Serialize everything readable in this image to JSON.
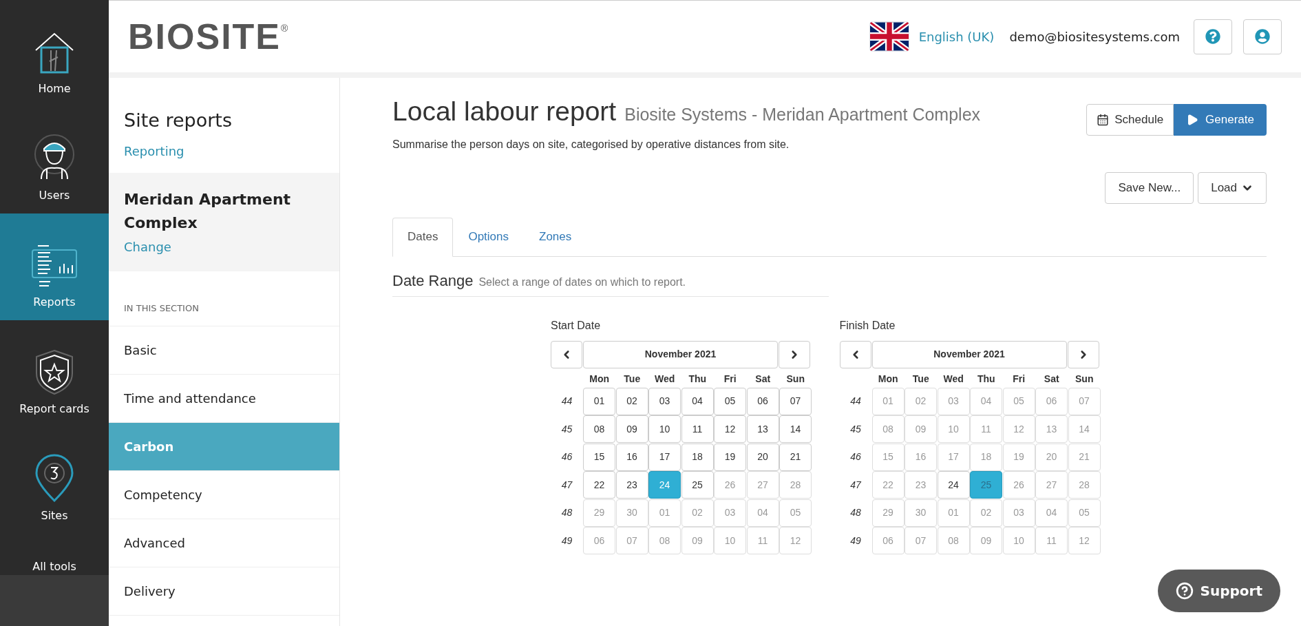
{
  "nav": [
    {
      "label": "Home",
      "kind": "house",
      "selected": false
    },
    {
      "label": "Users",
      "kind": "worker",
      "selected": false
    },
    {
      "label": "Reports",
      "kind": "report",
      "selected": true
    },
    {
      "label": "Report cards",
      "kind": "shield",
      "selected": false
    },
    {
      "label": "Sites",
      "kind": "pin",
      "selected": false
    },
    {
      "label": "All tools",
      "kind": "text",
      "selected": false
    }
  ],
  "header": {
    "logo": "BIOSITE",
    "logo_mark": "®",
    "language": "English (UK)",
    "email": "demo@biositesystems.com"
  },
  "sidebar": {
    "title": "Site reports",
    "link": "Reporting",
    "site": "Meridan Apartment Complex",
    "site_link": "Change",
    "section": "IN THIS SECTION",
    "items": [
      {
        "label": "Basic",
        "selected": false
      },
      {
        "label": "Time and attendance",
        "selected": false
      },
      {
        "label": "Carbon",
        "selected": true
      },
      {
        "label": "Competency",
        "selected": false
      },
      {
        "label": "Advanced",
        "selected": false
      },
      {
        "label": "Delivery",
        "selected": false
      }
    ]
  },
  "report": {
    "title": "Local labour report",
    "subtitle": "Biosite Systems - Meridan Apartment Complex",
    "description": "Summarise the person days on site, categorised by operative distances from site.",
    "buttons": [
      {
        "label": "Schedule",
        "kind": "schedule"
      },
      {
        "label": "Generate",
        "kind": "generate"
      }
    ],
    "save_buttons": [
      {
        "label": "Save New...",
        "kind": "plain"
      },
      {
        "label": "Load",
        "kind": "dropdown"
      }
    ]
  },
  "tabs": [
    {
      "label": "Dates",
      "selected": true
    },
    {
      "label": "Options",
      "selected": false
    },
    {
      "label": "Zones",
      "selected": false
    }
  ],
  "date_range": {
    "title": "Date Range",
    "hint": "Select a range of dates on which to report."
  },
  "calendars": [
    {
      "label": "Start Date",
      "month": "November 2021",
      "weekdays": [
        "Mon",
        "Tue",
        "Wed",
        "Thu",
        "Fri",
        "Sat",
        "Sun"
      ],
      "weeks": [
        {
          "week": "44",
          "days": [
            {
              "label": "01",
              "disabled": false,
              "selected": false
            },
            {
              "label": "02",
              "disabled": false,
              "selected": false
            },
            {
              "label": "03",
              "disabled": false,
              "selected": false
            },
            {
              "label": "04",
              "disabled": false,
              "selected": false
            },
            {
              "label": "05",
              "disabled": false,
              "selected": false
            },
            {
              "label": "06",
              "disabled": false,
              "selected": false
            },
            {
              "label": "07",
              "disabled": false,
              "selected": false
            }
          ]
        },
        {
          "week": "45",
          "days": [
            {
              "label": "08",
              "disabled": false,
              "selected": false
            },
            {
              "label": "09",
              "disabled": false,
              "selected": false
            },
            {
              "label": "10",
              "disabled": false,
              "selected": false
            },
            {
              "label": "11",
              "disabled": false,
              "selected": false
            },
            {
              "label": "12",
              "disabled": false,
              "selected": false
            },
            {
              "label": "13",
              "disabled": false,
              "selected": false
            },
            {
              "label": "14",
              "disabled": false,
              "selected": false
            }
          ]
        },
        {
          "week": "46",
          "days": [
            {
              "label": "15",
              "disabled": false,
              "selected": false
            },
            {
              "label": "16",
              "disabled": false,
              "selected": false
            },
            {
              "label": "17",
              "disabled": false,
              "selected": false
            },
            {
              "label": "18",
              "disabled": false,
              "selected": false
            },
            {
              "label": "19",
              "disabled": false,
              "selected": false
            },
            {
              "label": "20",
              "disabled": false,
              "selected": false
            },
            {
              "label": "21",
              "disabled": false,
              "selected": false
            }
          ]
        },
        {
          "week": "47",
          "days": [
            {
              "label": "22",
              "disabled": false,
              "selected": false
            },
            {
              "label": "23",
              "disabled": false,
              "selected": false
            },
            {
              "label": "24",
              "disabled": false,
              "selected": true
            },
            {
              "label": "25",
              "disabled": false,
              "selected": false
            },
            {
              "label": "26",
              "disabled": true,
              "selected": false
            },
            {
              "label": "27",
              "disabled": true,
              "selected": false
            },
            {
              "label": "28",
              "disabled": true,
              "selected": false
            }
          ]
        },
        {
          "week": "48",
          "days": [
            {
              "label": "29",
              "disabled": true,
              "selected": false
            },
            {
              "label": "30",
              "disabled": true,
              "selected": false
            },
            {
              "label": "01",
              "disabled": true,
              "selected": false
            },
            {
              "label": "02",
              "disabled": true,
              "selected": false
            },
            {
              "label": "03",
              "disabled": true,
              "selected": false
            },
            {
              "label": "04",
              "disabled": true,
              "selected": false
            },
            {
              "label": "05",
              "disabled": true,
              "selected": false
            }
          ]
        },
        {
          "week": "49",
          "days": [
            {
              "label": "06",
              "disabled": true,
              "selected": false
            },
            {
              "label": "07",
              "disabled": true,
              "selected": false
            },
            {
              "label": "08",
              "disabled": true,
              "selected": false
            },
            {
              "label": "09",
              "disabled": true,
              "selected": false
            },
            {
              "label": "10",
              "disabled": true,
              "selected": false
            },
            {
              "label": "11",
              "disabled": true,
              "selected": false
            },
            {
              "label": "12",
              "disabled": true,
              "selected": false
            }
          ]
        }
      ]
    },
    {
      "label": "Finish Date",
      "month": "November 2021",
      "weekdays": [
        "Mon",
        "Tue",
        "Wed",
        "Thu",
        "Fri",
        "Sat",
        "Sun"
      ],
      "weeks": [
        {
          "week": "44",
          "days": [
            {
              "label": "01",
              "disabled": true,
              "selected": false
            },
            {
              "label": "02",
              "disabled": true,
              "selected": false
            },
            {
              "label": "03",
              "disabled": true,
              "selected": false
            },
            {
              "label": "04",
              "disabled": true,
              "selected": false
            },
            {
              "label": "05",
              "disabled": true,
              "selected": false
            },
            {
              "label": "06",
              "disabled": true,
              "selected": false
            },
            {
              "label": "07",
              "disabled": true,
              "selected": false
            }
          ]
        },
        {
          "week": "45",
          "days": [
            {
              "label": "08",
              "disabled": true,
              "selected": false
            },
            {
              "label": "09",
              "disabled": true,
              "selected": false
            },
            {
              "label": "10",
              "disabled": true,
              "selected": false
            },
            {
              "label": "11",
              "disabled": true,
              "selected": false
            },
            {
              "label": "12",
              "disabled": true,
              "selected": false
            },
            {
              "label": "13",
              "disabled": true,
              "selected": false
            },
            {
              "label": "14",
              "disabled": true,
              "selected": false
            }
          ]
        },
        {
          "week": "46",
          "days": [
            {
              "label": "15",
              "disabled": true,
              "selected": false
            },
            {
              "label": "16",
              "disabled": true,
              "selected": false
            },
            {
              "label": "17",
              "disabled": true,
              "selected": false
            },
            {
              "label": "18",
              "disabled": true,
              "selected": false
            },
            {
              "label": "19",
              "disabled": true,
              "selected": false
            },
            {
              "label": "20",
              "disabled": true,
              "selected": false
            },
            {
              "label": "21",
              "disabled": true,
              "selected": false
            }
          ]
        },
        {
          "week": "47",
          "days": [
            {
              "label": "22",
              "disabled": true,
              "selected": false
            },
            {
              "label": "23",
              "disabled": true,
              "selected": false
            },
            {
              "label": "24",
              "disabled": false,
              "selected": false
            },
            {
              "label": "25",
              "disabled": true,
              "selected": true
            },
            {
              "label": "26",
              "disabled": true,
              "selected": false
            },
            {
              "label": "27",
              "disabled": true,
              "selected": false
            },
            {
              "label": "28",
              "disabled": true,
              "selected": false
            }
          ]
        },
        {
          "week": "48",
          "days": [
            {
              "label": "29",
              "disabled": true,
              "selected": false
            },
            {
              "label": "30",
              "disabled": true,
              "selected": false
            },
            {
              "label": "01",
              "disabled": true,
              "selected": false
            },
            {
              "label": "02",
              "disabled": true,
              "selected": false
            },
            {
              "label": "03",
              "disabled": true,
              "selected": false
            },
            {
              "label": "04",
              "disabled": true,
              "selected": false
            },
            {
              "label": "05",
              "disabled": true,
              "selected": false
            }
          ]
        },
        {
          "week": "49",
          "days": [
            {
              "label": "06",
              "disabled": true,
              "selected": false
            },
            {
              "label": "07",
              "disabled": true,
              "selected": false
            },
            {
              "label": "08",
              "disabled": true,
              "selected": false
            },
            {
              "label": "09",
              "disabled": true,
              "selected": false
            },
            {
              "label": "10",
              "disabled": true,
              "selected": false
            },
            {
              "label": "11",
              "disabled": true,
              "selected": false
            },
            {
              "label": "12",
              "disabled": true,
              "selected": false
            }
          ]
        }
      ]
    }
  ],
  "support": {
    "label": "Support"
  }
}
